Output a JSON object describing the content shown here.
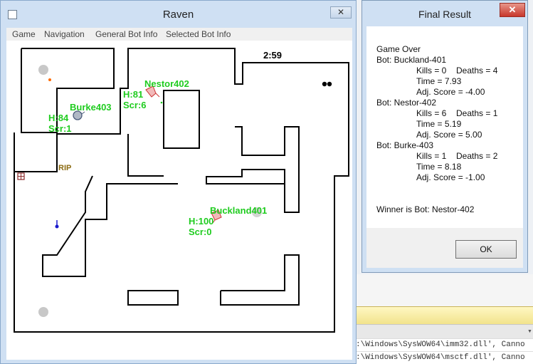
{
  "raven": {
    "title": "Raven",
    "close_glyph": "✕",
    "menu": [
      "Game",
      "Navigation",
      "General Bot Info",
      "Selected Bot Info"
    ],
    "timer": "2:59",
    "grave_label": "RIP",
    "bots": [
      {
        "name": "Nestor402",
        "health": "H:81",
        "score": "Scr:6",
        "color": "#e07070"
      },
      {
        "name": "Burke403",
        "health": "H:84",
        "score": "Scr:1",
        "color": "#6f8fb8"
      },
      {
        "name": "Buckland401",
        "health": "H:100",
        "score": "Scr:0",
        "color": "#e07070"
      }
    ]
  },
  "result": {
    "title": "Final Result",
    "close_glyph": "✕",
    "lines": [
      "Game Over",
      "Bot: Buckland-401",
      "Kills = 0",
      "Deaths = 4",
      "Time = 7.93",
      "Adj. Score = -4.00",
      "Bot: Nestor-402",
      "Kills = 6",
      "Deaths = 1",
      "Time = 5.19",
      "Adj. Score = 5.00",
      "Bot: Burke-403",
      "Kills = 1",
      "Deaths = 2",
      "Time = 8.18",
      "Adj. Score = -1.00",
      "Winner is Bot: Nestor-402"
    ],
    "ok_label": "OK"
  },
  "console": {
    "lines": [
      ":\\Windows\\SysWOW64\\imm32.dll', Canno",
      ":\\Windows\\SysWOW64\\msctf.dll', Canno"
    ]
  },
  "colors": {
    "window_frame": "#cfe0f3",
    "bot_label": "#1fcc1f",
    "close_red": "#c7372b"
  }
}
